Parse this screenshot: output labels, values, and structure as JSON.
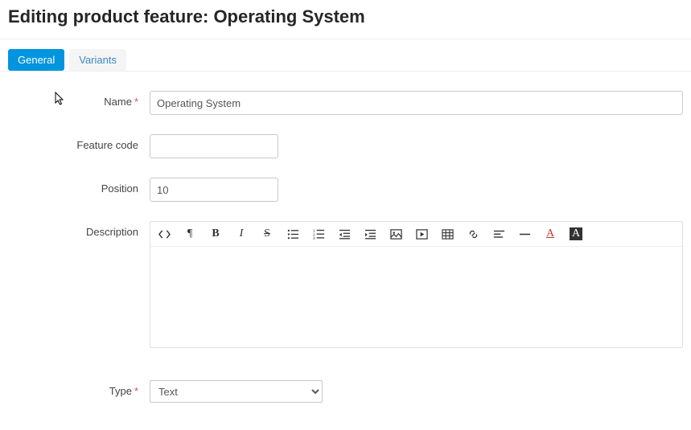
{
  "header": {
    "title": "Editing product feature: Operating System"
  },
  "tabs": {
    "general": "General",
    "variants": "Variants"
  },
  "form": {
    "name_label": "Name",
    "name_value": "Operating System",
    "feature_code_label": "Feature code",
    "feature_code_value": "",
    "position_label": "Position",
    "position_value": "10",
    "description_label": "Description",
    "description_value": "",
    "type_label": "Type",
    "type_value": "Text"
  },
  "toolbar": {
    "code": "code-view",
    "paragraph": "paragraph",
    "bold": "bold",
    "italic": "italic",
    "strike": "strike",
    "ul": "unordered-list",
    "ol": "ordered-list",
    "outdent": "outdent",
    "indent": "indent",
    "image": "image",
    "video": "video",
    "table": "table",
    "link": "link",
    "align": "align",
    "hr": "horizontal-rule",
    "textcolor": "text-color",
    "bgcolor": "background-color"
  }
}
